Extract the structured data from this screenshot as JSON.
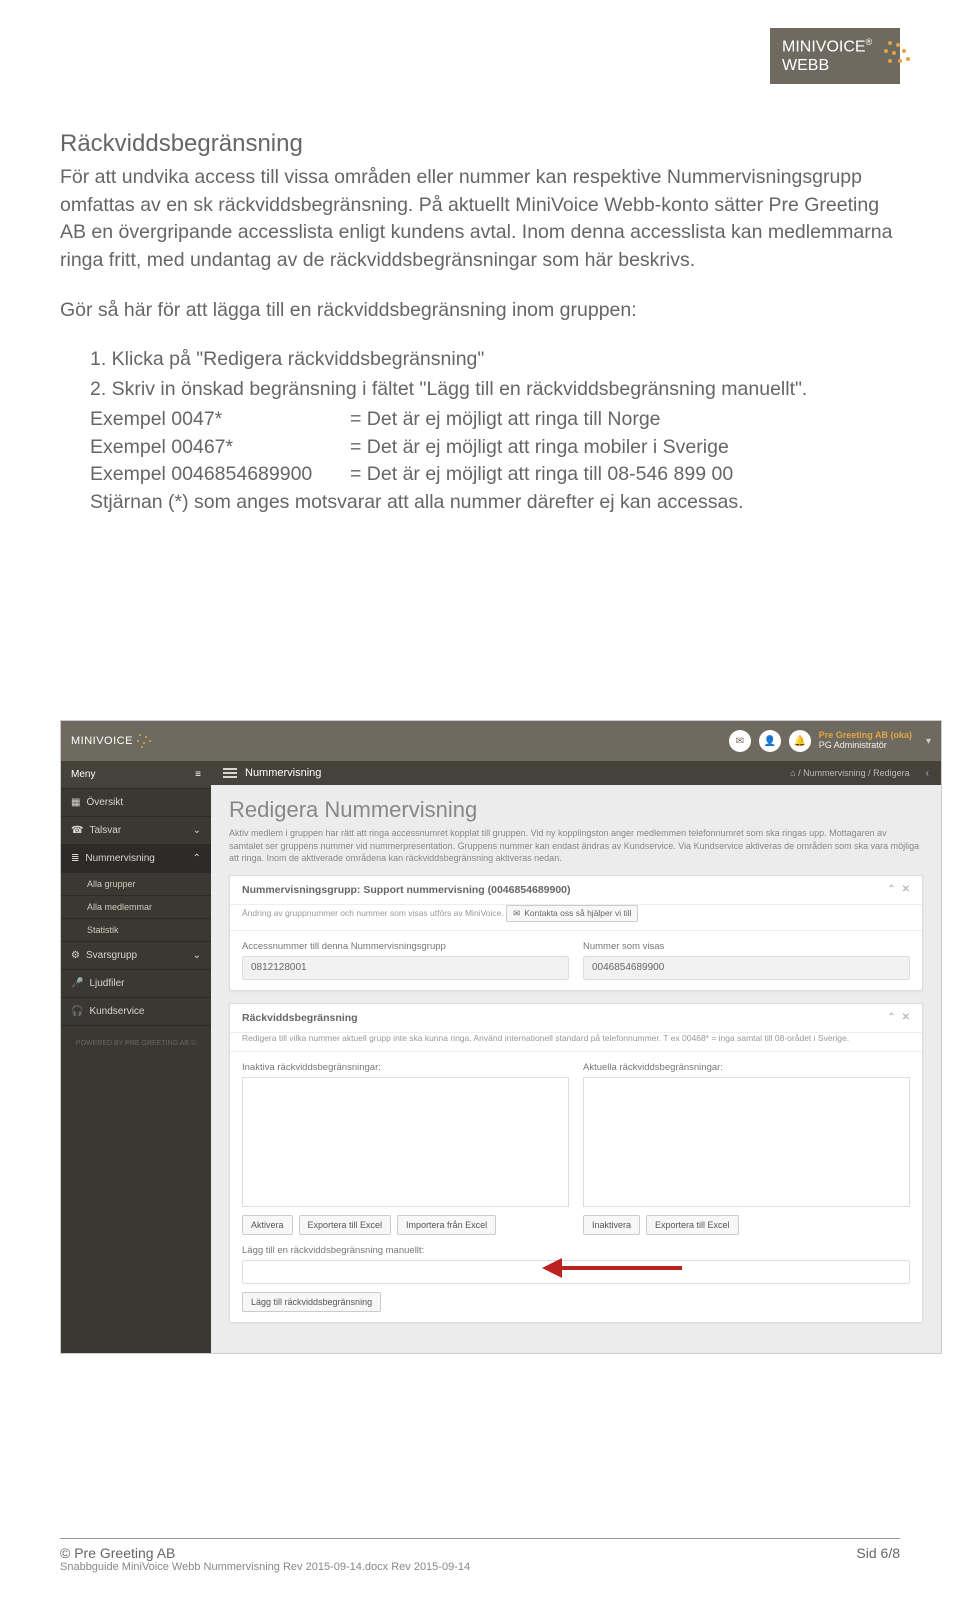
{
  "brand": {
    "line1": "MINIVOICE",
    "line2": "WEBB",
    "reg": "®"
  },
  "doc": {
    "title": "Räckviddsbegränsning",
    "para1": "För att undvika access till vissa områden eller nummer kan respektive Nummervisningsgrupp omfattas av en sk räckviddsbegränsning. På aktuellt MiniVoice Webb-konto sätter Pre Greeting AB en övergripande accesslista enligt kundens avtal. Inom denna accesslista kan medlemmarna ringa fritt, med undantag av de räckviddsbegränsningar som här beskrivs.",
    "stepsIntro": "Gör så här för att lägga till en räckviddsbegränsning inom gruppen:",
    "step1": "1.  Klicka på \"Redigera räckviddsbegränsning\"",
    "step2": "2.  Skriv in önskad begränsning i fältet \"Lägg till en räckviddsbegränsning manuellt\".",
    "ex1a": "Exempel 0047*",
    "ex1b": "= Det är ej möjligt att ringa till Norge",
    "ex2a": "Exempel 00467*",
    "ex2b": "= Det är ej möjligt att ringa mobiler i Sverige",
    "ex3a": "Exempel 0046854689900",
    "ex3b": "= Det är ej möjligt att ringa till 08-546 899 00",
    "tail": "Stjärnan (*) som anges motsvarar att alla nummer därefter ej kan accessas."
  },
  "app": {
    "logo": "MINIVOICE",
    "account": {
      "name": "Pre Greeting AB (oka)",
      "role": "PG Administratör"
    },
    "sidebar": {
      "menu": "Meny",
      "items": [
        {
          "label": "Översikt",
          "icon": "grid"
        },
        {
          "label": "Talsvar",
          "icon": "phone",
          "expand": "v"
        },
        {
          "label": "Nummervisning",
          "icon": "list",
          "expand": "^",
          "active": true
        }
      ],
      "subs": [
        "Alla grupper",
        "Alla medlemmar",
        "Statistik"
      ],
      "items2": [
        {
          "label": "Svarsgrupp",
          "icon": "sliders",
          "expand": "v"
        },
        {
          "label": "Ljudfiler",
          "icon": "mic"
        },
        {
          "label": "Kundservice",
          "icon": "headset"
        }
      ],
      "foot": "POWERED BY PRE GREETING AB ©"
    },
    "crumb": {
      "title": "Nummervisning",
      "path": "Nummervisning  /  Redigera",
      "home": "⌂"
    },
    "page": {
      "heading": "Redigera Nummervisning",
      "sub": "Aktiv medlem i gruppen har rätt att ringa accessnumret kopplat till gruppen. Vid ny kopplingston anger medlemmen telefonnumret som ska ringas upp. Mottagaren av samtalet ser gruppens nummer vid nummerpresentation. Gruppens nummer kan endast ändras av Kundservice. Via Kundservice aktiveras de områden som ska vara möjliga att ringa. Inom de aktiverade områdena kan räckviddsbegränsning aktiveras nedan."
    },
    "panel1": {
      "title": "Nummervisningsgrupp: Support nummervisning (0046854689900)",
      "sub": "Ändring av gruppnummer och nummer som visas utförs av MiniVoice.",
      "contact": "Kontakta oss så hjälper vi till",
      "field1Label": "Accessnummer till denna Nummervisningsgrupp",
      "field1Value": "0812128001",
      "field2Label": "Nummer som visas",
      "field2Value": "0046854689900"
    },
    "panel2": {
      "title": "Räckviddsbegränsning",
      "sub": "Redigera till vilka nummer aktuell grupp inte ska kunna ringa. Använd internationell standard på telefonnummer. T ex 00468* = inga samtal till 08-orådet i Sverige.",
      "leftLabel": "Inaktiva räckviddsbegränsningar:",
      "rightLabel": "Aktuella räckviddsbegränsningar:",
      "btnsLeft": [
        "Aktivera",
        "Exportera till Excel",
        "Importera från Excel"
      ],
      "btnsRight": [
        "Inaktivera",
        "Exportera till Excel"
      ],
      "manualLabel": "Lägg till en räckviddsbegränsning manuellt:",
      "addBtn": "Lägg till räckviddsbegränsning"
    }
  },
  "footer": {
    "copyright": "© Pre Greeting AB",
    "filename": "Snabbguide MiniVoice Webb Nummervisning Rev 2015-09-14.docx Rev 2015-09-14",
    "page": "Sid 6/8"
  }
}
